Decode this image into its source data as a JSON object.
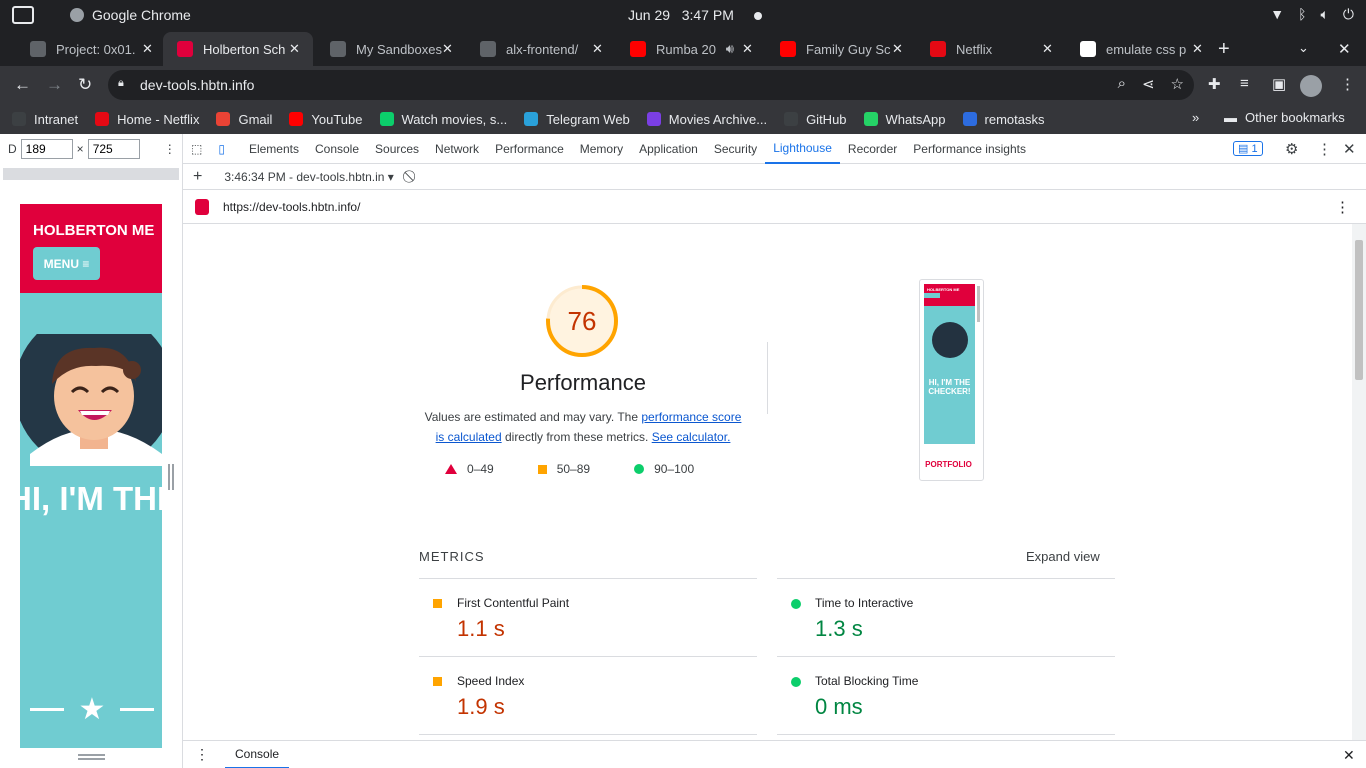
{
  "os_bar": {
    "app_name": "Google Chrome",
    "date": "Jun 29",
    "time": "3:47 PM"
  },
  "tabs": [
    {
      "title": "Project: 0x01.",
      "favicon": "github-icon",
      "active": false
    },
    {
      "title": "Holberton Sch",
      "favicon": "holberton-icon",
      "active": true
    },
    {
      "title": "My Sandboxes",
      "favicon": "github-icon",
      "active": false
    },
    {
      "title": "alx-frontend/",
      "favicon": "github-icon",
      "active": false
    },
    {
      "title": "Rumba 20",
      "favicon": "youtube-icon",
      "active": false,
      "audio": true
    },
    {
      "title": "Family Guy Sc",
      "favicon": "youtube-icon",
      "active": false
    },
    {
      "title": "Netflix",
      "favicon": "netflix-icon",
      "active": false
    },
    {
      "title": "emulate css p",
      "favicon": "google-icon",
      "active": false
    }
  ],
  "address": {
    "url": "dev-tools.hbtn.info"
  },
  "bookmarks": [
    {
      "label": "Intranet",
      "icon": "holberton-icon",
      "color": "#3c4043"
    },
    {
      "label": "Home - Netflix",
      "icon": "netflix-icon",
      "color": "#e50914"
    },
    {
      "label": "Gmail",
      "icon": "gmail-icon",
      "color": "#ea4335"
    },
    {
      "label": "YouTube",
      "icon": "youtube-icon",
      "color": "#ff0000"
    },
    {
      "label": "Watch movies, s...",
      "icon": "play-icon",
      "color": "#0cce6b"
    },
    {
      "label": "Telegram Web",
      "icon": "telegram-icon",
      "color": "#2aa1da"
    },
    {
      "label": "Movies Archive...",
      "icon": "movies-icon",
      "color": "#7b3fe4"
    },
    {
      "label": "GitHub",
      "icon": "github-icon",
      "color": "#3c4043"
    },
    {
      "label": "WhatsApp",
      "icon": "whatsapp-icon",
      "color": "#25d366"
    },
    {
      "label": "remotasks",
      "icon": "remotasks-icon",
      "color": "#2d6cdf"
    }
  ],
  "other_bookmarks": "Other bookmarks",
  "device": {
    "label": "D",
    "width": "189",
    "height": "725"
  },
  "preview": {
    "brand": "HOLBERTON ME",
    "menu": "MENU ≡",
    "hero_text": "HI, I'M THE CHECKER"
  },
  "devtools": {
    "tabs": [
      "Elements",
      "Console",
      "Sources",
      "Network",
      "Performance",
      "Memory",
      "Application",
      "Security",
      "Lighthouse",
      "Recorder",
      "Performance insights"
    ],
    "active_tab": "Lighthouse",
    "issues_count": "1",
    "report_select": "3:46:34 PM - dev-tools.hbtn.in",
    "report_url": "https://dev-tools.hbtn.info/",
    "drawer_tab": "Console"
  },
  "lighthouse": {
    "score": 76,
    "category": "Performance",
    "desc_pre": "Values are estimated and may vary. The ",
    "desc_link1": "performance score is calculated",
    "desc_mid": " directly from these metrics. ",
    "desc_link2": "See calculator.",
    "legend": [
      "0–49",
      "50–89",
      "90–100"
    ],
    "thumbnail": {
      "brand": "HOLBERTON ME",
      "hero_text": "HI, I'M THE CHECKER!",
      "footer": "PORTFOLIO"
    },
    "metrics_title": "METRICS",
    "expand_label": "Expand view",
    "metrics": [
      {
        "name": "First Contentful Paint",
        "value": "1.1 s",
        "rating": "average"
      },
      {
        "name": "Time to Interactive",
        "value": "1.3 s",
        "rating": "pass"
      },
      {
        "name": "Speed Index",
        "value": "1.9 s",
        "rating": "average"
      },
      {
        "name": "Total Blocking Time",
        "value": "0 ms",
        "rating": "pass"
      }
    ]
  },
  "colors": {
    "fail": "#e0003c",
    "average": "#ffa400",
    "pass": "#0cce6b",
    "accent": "#1a73e8"
  }
}
